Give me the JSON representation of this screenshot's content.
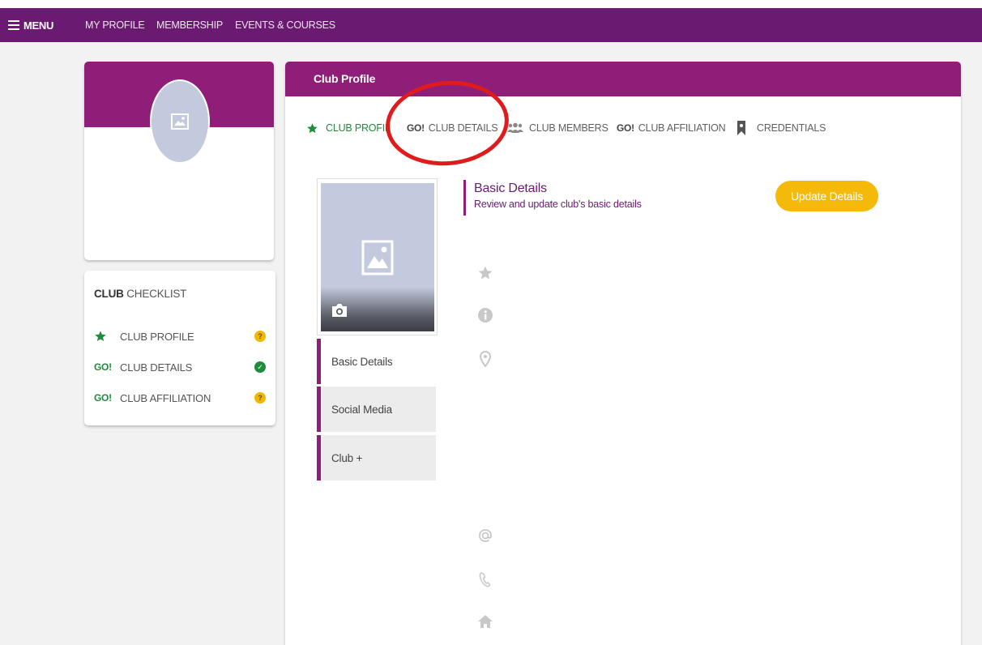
{
  "topbar": {
    "menu_label": "MENU",
    "links": [
      "MY PROFILE",
      "MEMBERSHIP",
      "EVENTS & COURSES"
    ]
  },
  "checklist": {
    "title_bold": "CLUB",
    "title_rest": " CHECKLIST",
    "items": [
      {
        "icon": "star-icon",
        "label": "CLUB PROFILE",
        "status": "warning"
      },
      {
        "icon": "go-icon",
        "label": "CLUB DETAILS",
        "status": "complete"
      },
      {
        "icon": "go-icon",
        "label": "CLUB AFFILIATION",
        "status": "warning"
      }
    ]
  },
  "main": {
    "title": "Club Profile",
    "tabs": [
      {
        "icon": "star-icon",
        "label": "CLUB PROFIL",
        "active": true
      },
      {
        "icon": "go-icon",
        "label": "CLUB DETAILS"
      },
      {
        "icon": "members-icon",
        "label": "CLUB MEMBERS"
      },
      {
        "icon": "go-icon",
        "label": "CLUB AFFILIATION"
      },
      {
        "icon": "bookmark-icon",
        "label": "CREDENTIALS"
      }
    ],
    "go_text": "GO!",
    "sidenav": [
      "Basic Details",
      "Social Media",
      "Club +"
    ],
    "section": {
      "title": "Basic Details",
      "subtitle": "Review and update club's basic details"
    },
    "update_button": "Update Details",
    "field_icons": [
      "star-icon",
      "info-icon",
      "location-pin-icon",
      "at-icon",
      "phone-icon",
      "home-icon"
    ]
  },
  "colors": {
    "topbar": "#6b1a72",
    "header": "#8e1e78",
    "accent_green": "#1e8c3a",
    "button_yellow": "#f5b90a",
    "annotation_red": "#e01b1b"
  }
}
